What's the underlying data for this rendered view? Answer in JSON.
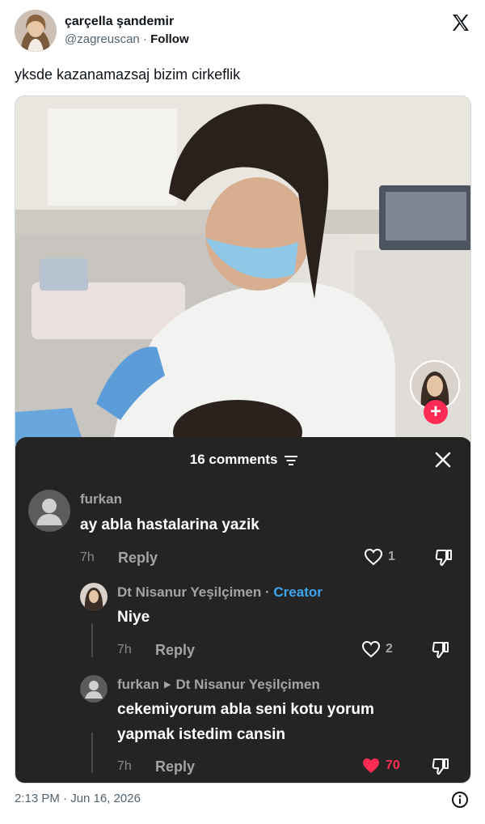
{
  "tweet": {
    "display_name": "çarçella şandemir",
    "handle": "@zagreuscan",
    "separator": " · ",
    "follow_label": "Follow",
    "text": "yksde kazanamazsaj bizim cirkeflik",
    "timestamp": "2:13 PM · Jun 16, 2026"
  },
  "comments_sheet": {
    "title": "16 comments",
    "comments": [
      {
        "user": "furkan",
        "text": "ay abla hastalarina yazik",
        "time": "7h",
        "reply_label": "Reply",
        "likes": "1",
        "liked": false
      },
      {
        "user": "Dt Nisanur Yeşilçimen",
        "creator_label": "Creator",
        "text": "Niye",
        "time": "7h",
        "reply_label": "Reply",
        "likes": "2",
        "liked": false
      },
      {
        "user": "furkan",
        "reply_to": "Dt Nisanur Yeşilçimen",
        "text_line1": "cekemiyorum abla seni kotu yorum",
        "text_line2": "yapmak istedim cansin",
        "time": "7h",
        "reply_label": "Reply",
        "likes": "70",
        "liked": true
      }
    ]
  },
  "colors": {
    "sheet_bg": "#242424",
    "creator_blue": "#3da6f2",
    "like_red": "#fe2c55",
    "muted_text": "#a4a4a4"
  },
  "icons": [
    "x-logo-icon",
    "sort-icon",
    "close-icon",
    "heart-icon",
    "dislike-icon",
    "info-icon",
    "plus-icon"
  ]
}
